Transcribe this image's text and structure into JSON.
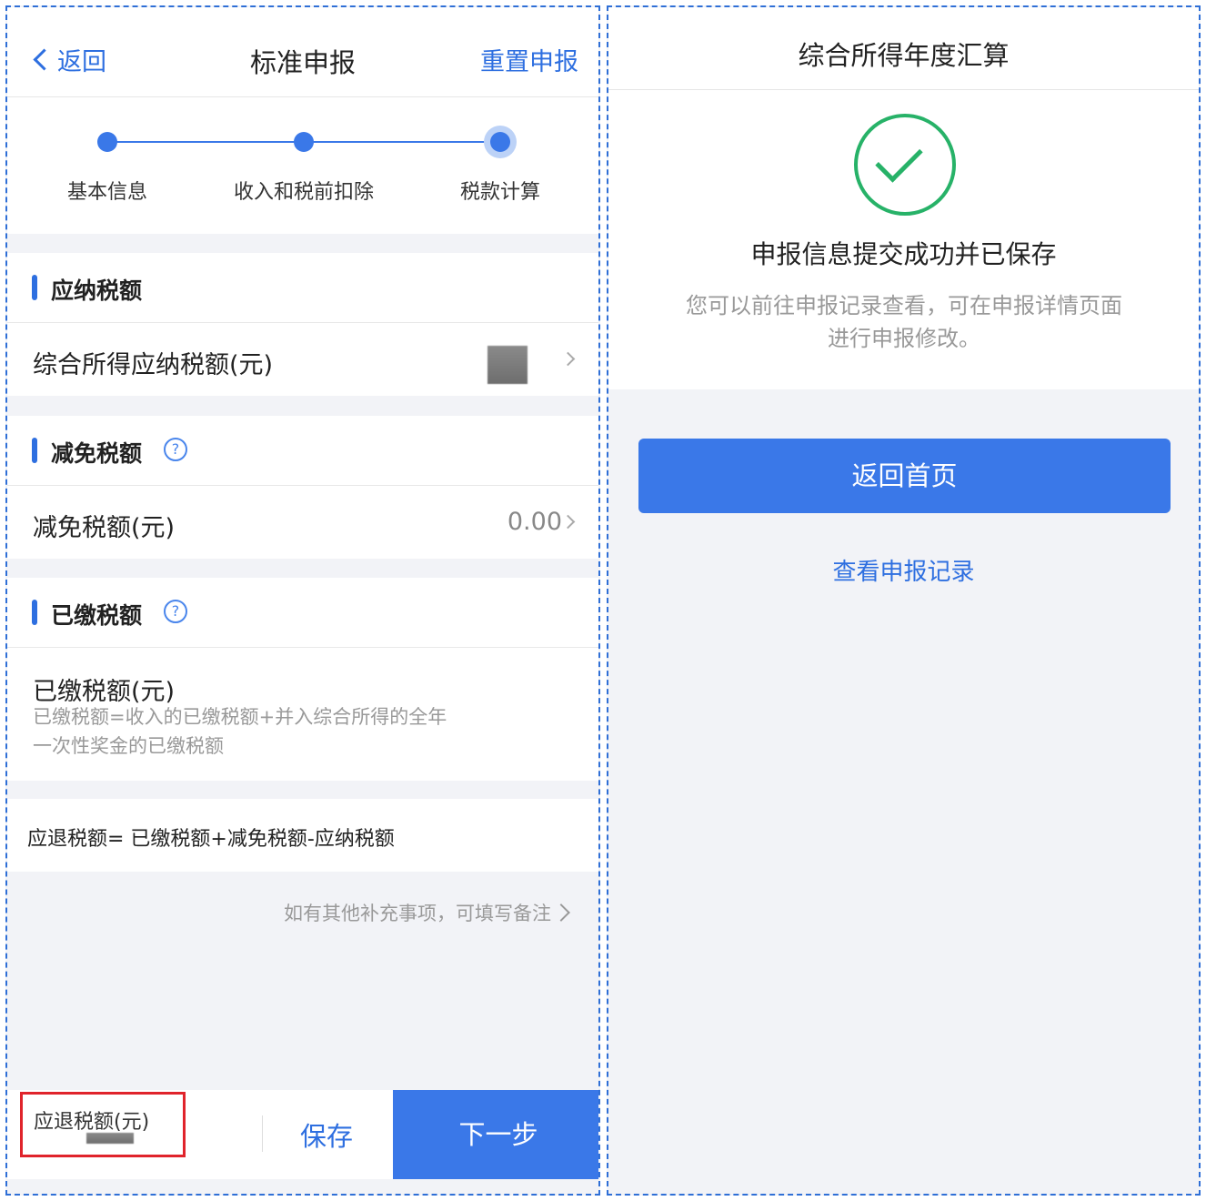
{
  "left": {
    "nav": {
      "back": "返回",
      "title": "标准申报",
      "reset": "重置申报"
    },
    "steps": [
      "基本信息",
      "收入和税前扣除",
      "税款计算"
    ],
    "section_payable": {
      "title": "应纳税额",
      "row_label": "综合所得应纳税额(元)"
    },
    "section_reduction": {
      "title": "减免税额",
      "row_label": "减免税额(元)",
      "row_value": "0.00"
    },
    "section_paid": {
      "title": "已缴税额",
      "row_label": "已缴税额(元)",
      "desc_line1": "已缴税额=收入的已缴税额+并入综合所得的全年",
      "desc_line2": "一次性奖金的已缴税额"
    },
    "formula": "应退税额= 已缴税额+减免税额-应纳税额",
    "note": "如有其他补充事项，可填写备注",
    "footer": {
      "refund_label": "应退税额(元)",
      "save": "保存",
      "next": "下一步"
    }
  },
  "right": {
    "title": "综合所得年度汇算",
    "success": "申报信息提交成功并已保存",
    "sub_line1": "您可以前往申报记录查看，可在申报详情页面",
    "sub_line2": "进行申报修改。",
    "home_button": "返回首页",
    "records_link": "查看申报记录"
  },
  "colors": {
    "accent": "#3a78e8",
    "success": "#27b268",
    "highlight": "#e0242b"
  }
}
